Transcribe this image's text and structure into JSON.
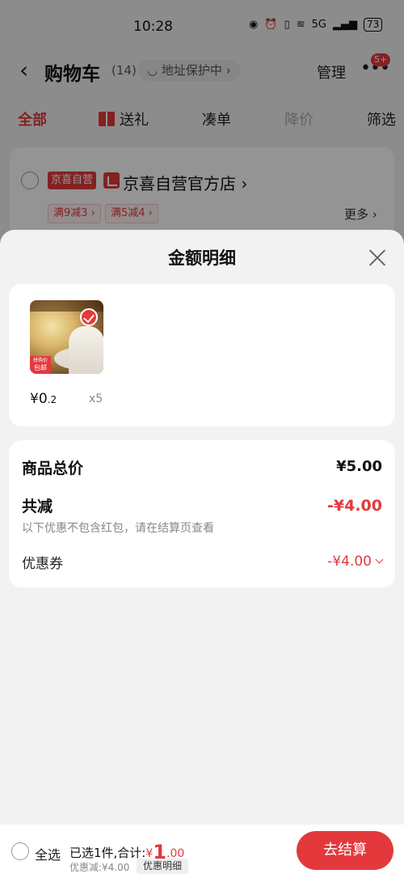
{
  "status_bar": {
    "time": "10:28",
    "network": "5G",
    "battery": "73"
  },
  "nav": {
    "title": "购物车",
    "count": "(14)",
    "address": "地址保护中",
    "manage": "管理",
    "more_badge": "5+"
  },
  "tabs": [
    "全部",
    "送礼",
    "凑单",
    "降价",
    "筛选"
  ],
  "store": {
    "tag": "京喜自营",
    "name": "京喜自营官方店",
    "promos": [
      "满9减3",
      "满5减4"
    ],
    "more": "更多"
  },
  "sheet": {
    "title": "金额明细",
    "product": {
      "price_symbol": "¥0",
      "price_decimal": ".2",
      "quantity": "x5",
      "badge": "包邮",
      "badge_top": "拼购价"
    },
    "summary": {
      "total_label": "商品总价",
      "total_value": "¥5.00",
      "reduce_label": "共减",
      "reduce_value": "-¥4.00",
      "reduce_note": "以下优惠不包含红包，请在结算页查看",
      "coupon_label": "优惠券",
      "coupon_value": "-¥4.00"
    }
  },
  "bottom_bar": {
    "select_all": "全选",
    "selected_text": "已选1件,合计:",
    "total_currency": "¥",
    "total_int": "1",
    "total_decimal": ".00",
    "discount_text": "优惠减:¥4.00",
    "detail_button": "优惠明细",
    "checkout_button": "去结算"
  },
  "colors": {
    "accent": "#e4393c",
    "background": "#f2f2f2"
  }
}
